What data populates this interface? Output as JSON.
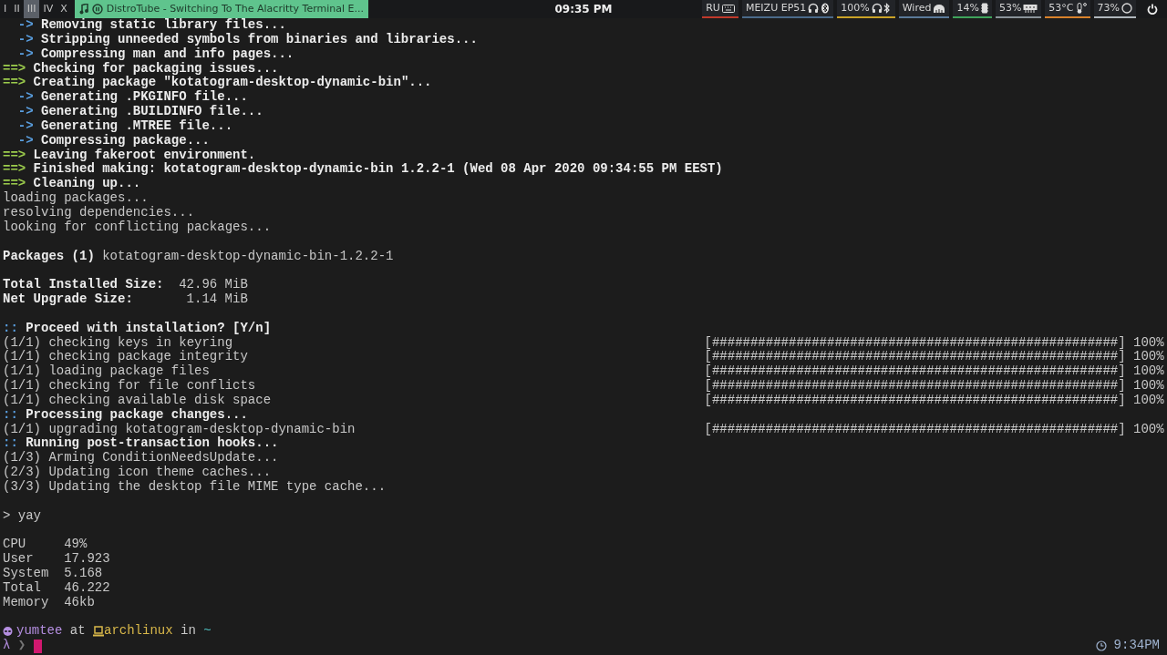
{
  "top_bar": {
    "workspaces": [
      {
        "label": "I",
        "selected": false
      },
      {
        "label": "II",
        "selected": false
      },
      {
        "label": "III",
        "selected": true
      },
      {
        "label": "IV",
        "selected": false
      },
      {
        "label": "X",
        "selected": false
      }
    ],
    "window_title": "DistroTube - Switching To The Alacritty Terminal E...",
    "clock": "09:35 PM",
    "widgets": [
      {
        "text": "RU",
        "kind": "keyboard",
        "color": "#c0392b"
      },
      {
        "text": "MEIZU EP51",
        "kind": "headset",
        "color": "#4a6a8a"
      },
      {
        "text": "100%",
        "kind": "headphones",
        "color": "#c9a227"
      },
      {
        "text": "Wired",
        "kind": "network",
        "color": "#5b7a99"
      },
      {
        "text": "14%",
        "kind": "cpu",
        "color": "#3fa35b"
      },
      {
        "text": "53%",
        "kind": "memory",
        "color": "#8a9399"
      },
      {
        "text": "53°C",
        "kind": "temperature",
        "color": "#d9822b"
      },
      {
        "text": "73%",
        "kind": "disk",
        "color": "#b0b7bd"
      }
    ]
  },
  "terminal": {
    "lines": [
      {
        "kind": "arrow",
        "marker": "->",
        "text": "Removing static library files..."
      },
      {
        "kind": "arrow",
        "marker": "->",
        "text": "Stripping unneeded symbols from binaries and libraries..."
      },
      {
        "kind": "arrow",
        "marker": "->",
        "text": "Compressing man and info pages..."
      },
      {
        "kind": "step",
        "marker": "==>",
        "text": "Checking for packaging issues..."
      },
      {
        "kind": "step",
        "marker": "==>",
        "text": "Creating package \"kotatogram-desktop-dynamic-bin\"..."
      },
      {
        "kind": "arrow",
        "marker": "->",
        "text": "Generating .PKGINFO file..."
      },
      {
        "kind": "arrow",
        "marker": "->",
        "text": "Generating .BUILDINFO file..."
      },
      {
        "kind": "arrow",
        "marker": "->",
        "text": "Generating .MTREE file..."
      },
      {
        "kind": "arrow",
        "marker": "->",
        "text": "Compressing package..."
      },
      {
        "kind": "step",
        "marker": "==>",
        "text": "Leaving fakeroot environment."
      },
      {
        "kind": "step",
        "marker": "==>",
        "text": "Finished making: kotatogram-desktop-dynamic-bin 1.2.2-1 (Wed 08 Apr 2020 09:34:55 PM EEST)"
      },
      {
        "kind": "step",
        "marker": "==>",
        "text": "Cleaning up..."
      },
      {
        "kind": "plain",
        "text": "loading packages..."
      },
      {
        "kind": "plain",
        "text": "resolving dependencies..."
      },
      {
        "kind": "plain",
        "text": "looking for conflicting packages..."
      },
      {
        "kind": "blank"
      },
      {
        "kind": "kv",
        "label": "Packages (1)",
        "value": "kotatogram-desktop-dynamic-bin-1.2.2-1"
      },
      {
        "kind": "blank"
      },
      {
        "kind": "size",
        "label": "Total Installed Size:",
        "value": "42.96 MiB"
      },
      {
        "kind": "size",
        "label": "Net Upgrade Size:",
        "value": "1.14 MiB"
      },
      {
        "kind": "blank"
      },
      {
        "kind": "info",
        "marker": "::",
        "text": "Proceed with installation? [Y/n]"
      },
      {
        "kind": "progress",
        "text": "(1/1) checking keys in keyring",
        "bar": "[#####################################################]",
        "percent": "100%"
      },
      {
        "kind": "progress",
        "text": "(1/1) checking package integrity",
        "bar": "[#####################################################]",
        "percent": "100%"
      },
      {
        "kind": "progress",
        "text": "(1/1) loading package files",
        "bar": "[#####################################################]",
        "percent": "100%"
      },
      {
        "kind": "progress",
        "text": "(1/1) checking for file conflicts",
        "bar": "[#####################################################]",
        "percent": "100%"
      },
      {
        "kind": "progress",
        "text": "(1/1) checking available disk space",
        "bar": "[#####################################################]",
        "percent": "100%"
      },
      {
        "kind": "info",
        "marker": "::",
        "text": "Processing package changes..."
      },
      {
        "kind": "progress",
        "text": "(1/1) upgrading kotatogram-desktop-dynamic-bin",
        "bar": "[#####################################################]",
        "percent": "100%"
      },
      {
        "kind": "info",
        "marker": "::",
        "text": "Running post-transaction hooks..."
      },
      {
        "kind": "plain",
        "text": "(1/3) Arming ConditionNeedsUpdate..."
      },
      {
        "kind": "plain",
        "text": "(2/3) Updating icon theme caches..."
      },
      {
        "kind": "plain",
        "text": "(3/3) Updating the desktop file MIME type cache..."
      },
      {
        "kind": "blank"
      },
      {
        "kind": "command",
        "marker": ">",
        "text": "yay"
      },
      {
        "kind": "blank"
      },
      {
        "kind": "stat",
        "label": "CPU",
        "value": "49%"
      },
      {
        "kind": "stat",
        "label": "User",
        "value": "17.923"
      },
      {
        "kind": "stat",
        "label": "System",
        "value": "5.168"
      },
      {
        "kind": "stat",
        "label": "Total",
        "value": "46.222"
      },
      {
        "kind": "stat",
        "label": "Memory",
        "value": "46kb"
      },
      {
        "kind": "blank"
      }
    ],
    "prompt": {
      "user": "yumtee",
      "at": "at",
      "host": "archlinux",
      "in": "in",
      "dir": "~",
      "symbol": "λ",
      "arrow": "❯",
      "time": "9:34PM"
    }
  }
}
